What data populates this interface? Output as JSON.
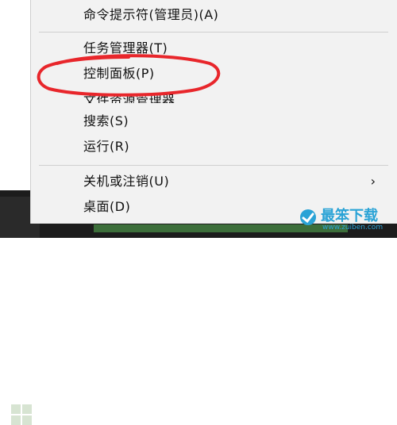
{
  "menu": {
    "items": [
      {
        "label": "命令提示符(管理员)(A)"
      },
      {
        "label": "任务管理器(T)"
      },
      {
        "label": "控制面板(P)"
      },
      {
        "label": "文件资源管理器"
      },
      {
        "label": "搜索(S)"
      },
      {
        "label": "运行(R)"
      },
      {
        "label": "关机或注销(U)",
        "arrow": "›"
      },
      {
        "label": "桌面(D)"
      }
    ]
  },
  "highlight_color": "#e8262b",
  "watermark": {
    "brand": "最笨下载",
    "url": "www.zuiben.com",
    "color": "#2aa3d6"
  }
}
